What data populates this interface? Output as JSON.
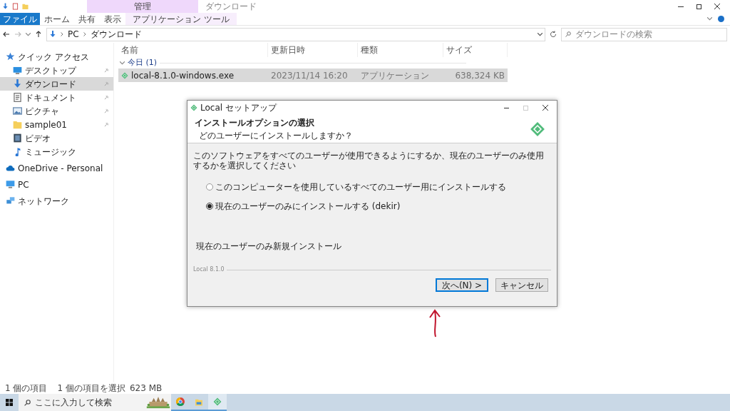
{
  "window": {
    "title": "ダウンロード",
    "context_group": "管理"
  },
  "ribbon_tabs": [
    {
      "label": "ファイル",
      "kind": "file"
    },
    {
      "label": "ホーム",
      "kind": "normal"
    },
    {
      "label": "共有",
      "kind": "normal"
    },
    {
      "label": "表示",
      "kind": "normal"
    },
    {
      "label": "アプリケーション ツール",
      "kind": "context"
    }
  ],
  "breadcrumb": [
    "PC",
    "ダウンロード"
  ],
  "search": {
    "placeholder": "ダウンロードの検索"
  },
  "sidebar": {
    "items": [
      {
        "label": "クイック アクセス",
        "kind": "star",
        "pinned": false,
        "selected": false
      },
      {
        "label": "デスクトップ",
        "kind": "desktop",
        "pinned": true,
        "selected": false
      },
      {
        "label": "ダウンロード",
        "kind": "download",
        "pinned": true,
        "selected": true
      },
      {
        "label": "ドキュメント",
        "kind": "document",
        "pinned": true,
        "selected": false
      },
      {
        "label": "ピクチャ",
        "kind": "picture",
        "pinned": true,
        "selected": false
      },
      {
        "label": "sample01",
        "kind": "folder",
        "pinned": true,
        "selected": false
      },
      {
        "label": "ビデオ",
        "kind": "video",
        "pinned": false,
        "selected": false
      },
      {
        "label": "ミュージック",
        "kind": "music",
        "pinned": false,
        "selected": false
      },
      {
        "label": "OneDrive - Personal",
        "kind": "cloud",
        "pinned": false,
        "selected": false
      },
      {
        "label": "PC",
        "kind": "pc",
        "pinned": false,
        "selected": false
      },
      {
        "label": "ネットワーク",
        "kind": "network",
        "pinned": false,
        "selected": false
      }
    ]
  },
  "table": {
    "columns": [
      "名前",
      "更新日時",
      "種類",
      "サイズ"
    ],
    "group": "今日 (1)",
    "rows": [
      {
        "name": "local-8.1.0-windows.exe",
        "modified": "2023/11/14 16:20",
        "type": "アプリケーション",
        "size": "638,324 KB",
        "selected": true
      }
    ]
  },
  "status_bar": {
    "count": "1 個の項目",
    "selection": "1 個の項目を選択",
    "size": "623 MB"
  },
  "dialog": {
    "title": "Local セットアップ",
    "heading": "インストールオプションの選択",
    "subheading": "どのユーザーにインストールしますか？",
    "description": "このソフトウェアをすべてのユーザーが使用できるようにするか、現在のユーザーのみ使用するかを選択してください",
    "options": [
      {
        "label": "このコンピューターを使用しているすべてのユーザー用にインストールする",
        "selected": false
      },
      {
        "label": "現在のユーザーのみにインストールする (dekir)",
        "selected": true
      }
    ],
    "note": "現在のユーザーのみ新規インストール",
    "version": "Local 8.1.0",
    "buttons": [
      {
        "label": "次へ(N) >",
        "focused": true
      },
      {
        "label": "キャンセル",
        "focused": false
      }
    ]
  },
  "taskbar": {
    "search_placeholder": "ここに入力して検索"
  }
}
